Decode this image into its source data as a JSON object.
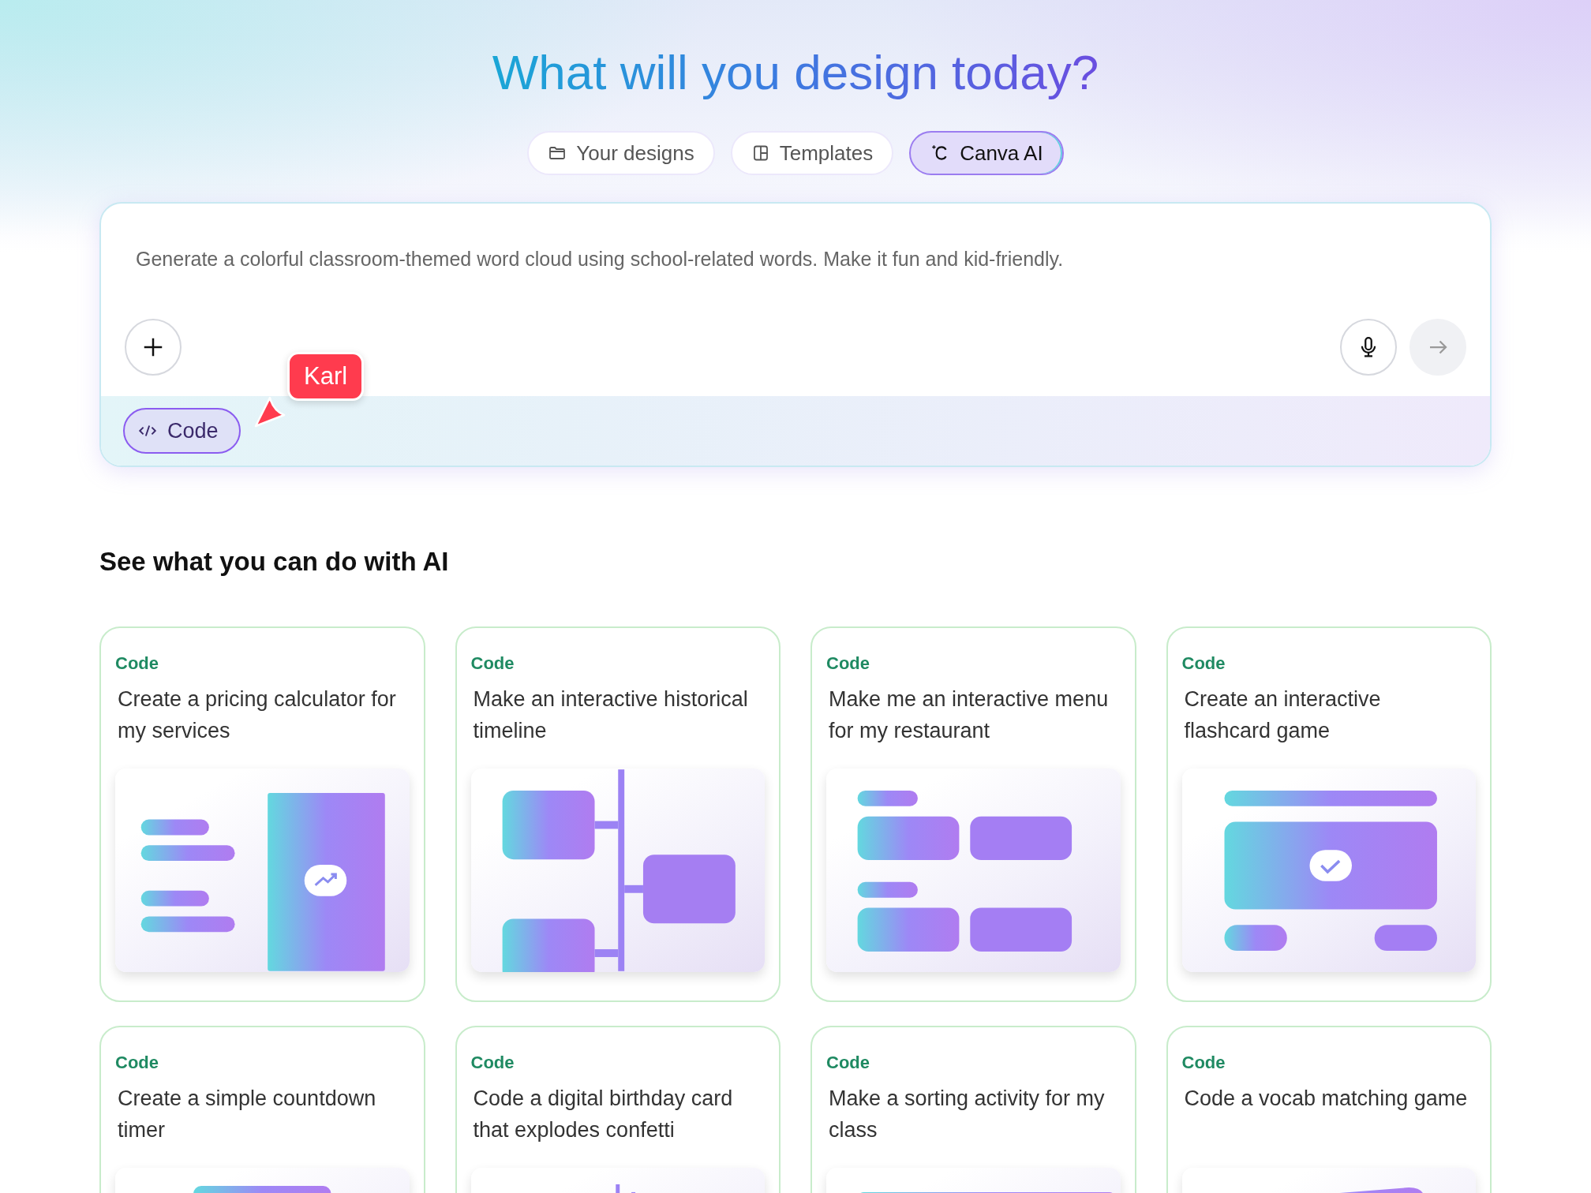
{
  "title": "What will you design today?",
  "tabs": [
    {
      "label": "Your designs",
      "selected": false
    },
    {
      "label": "Templates",
      "selected": false
    },
    {
      "label": "Canva AI",
      "selected": true
    }
  ],
  "prompt": {
    "placeholder": "Generate a colorful classroom-themed word cloud using school-related words. Make it fun and kid-friendly.",
    "chip": {
      "label": "Code",
      "selected": true
    }
  },
  "collaborator_cursor": {
    "name": "Karl",
    "color": "#ff3b4e"
  },
  "section_title": "See what you can do with AI",
  "cards": [
    {
      "tag": "Code",
      "text": "Create a pricing calculator for my services"
    },
    {
      "tag": "Code",
      "text": "Make an interactive historical timeline"
    },
    {
      "tag": "Code",
      "text": "Make me an interactive menu for my restaurant"
    },
    {
      "tag": "Code",
      "text": "Create an interactive flashcard game"
    },
    {
      "tag": "Code",
      "text": "Create a simple countdown timer"
    },
    {
      "tag": "Code",
      "text": "Code a digital birthday card that explodes confetti"
    },
    {
      "tag": "Code",
      "text": "Make a sorting activity for my class"
    },
    {
      "tag": "Code",
      "text": "Code a vocab matching game"
    }
  ]
}
